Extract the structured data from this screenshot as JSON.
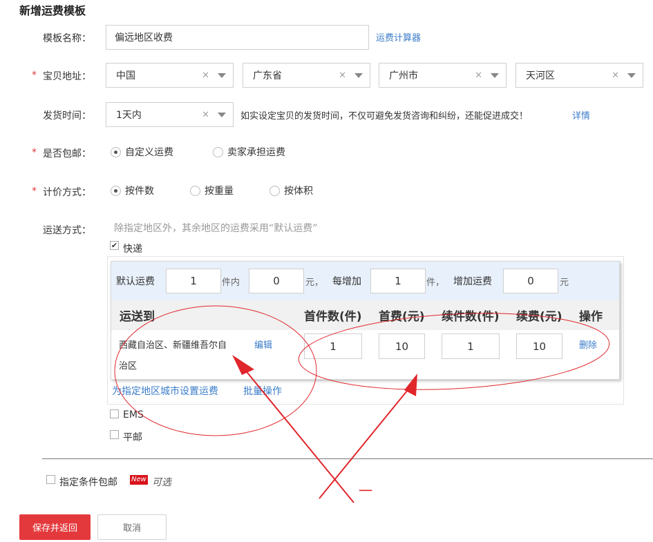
{
  "page_title": "新增运费模板",
  "form": {
    "template_name": {
      "label": "模板名称：",
      "value": "偏远地区收费",
      "calc_link": "运费计算器"
    },
    "address": {
      "label": "宝贝地址：",
      "country": "中国",
      "province": "广东省",
      "city": "广州市",
      "district": "天河区",
      "clear": "×"
    },
    "ship_time": {
      "label": "发货时间：",
      "value": "1天内",
      "hint": "如实设定宝贝的发货时间，不仅可避免发货咨询和纠纷，还能促进成交！",
      "detail_link": "详情"
    },
    "free_shipping": {
      "label": "是否包邮：",
      "opt1": "自定义运费",
      "opt2": "卖家承担运费"
    },
    "pricing": {
      "label": "计价方式：",
      "opt1": "按件数",
      "opt2": "按重量",
      "opt3": "按体积"
    },
    "delivery": {
      "label": "运送方式：",
      "hint": "除指定地区外，其余地区的运费采用“默认运费”",
      "express": "快递",
      "ems": "EMS",
      "post": "平邮",
      "check_mark": "✔"
    },
    "required_mark": "*"
  },
  "default_fee": {
    "label": "默认运费",
    "first_qty": "1",
    "within": "件内",
    "first_fee": "0",
    "yuan_sep": "元，",
    "each_add": "每增加",
    "add_qty": "1",
    "piece_sep": "件，",
    "add_fee_label": "增加运费",
    "add_fee": "0",
    "yuan": "元"
  },
  "table": {
    "headers": [
      "运送到",
      "首件数(件)",
      "首费(元)",
      "续件数(件)",
      "续费(元)",
      "操作"
    ],
    "row": {
      "regions_line1": "西藏自治区、新疆维吾尔自",
      "regions_line2": "治区",
      "edit": "编辑",
      "first_qty": "1",
      "first_fee": "10",
      "add_qty": "1",
      "add_fee": "10",
      "delete": "删除"
    }
  },
  "panel_links": {
    "set_city": "为指定地区城市设置运费",
    "batch": "批量操作"
  },
  "conditional": {
    "label": "指定条件包邮",
    "badge": "New",
    "optional": "可选"
  },
  "buttons": {
    "save": "保存并返回",
    "cancel": "取消"
  },
  "annotation": {
    "mark": "一",
    "color": "#e0262b"
  }
}
